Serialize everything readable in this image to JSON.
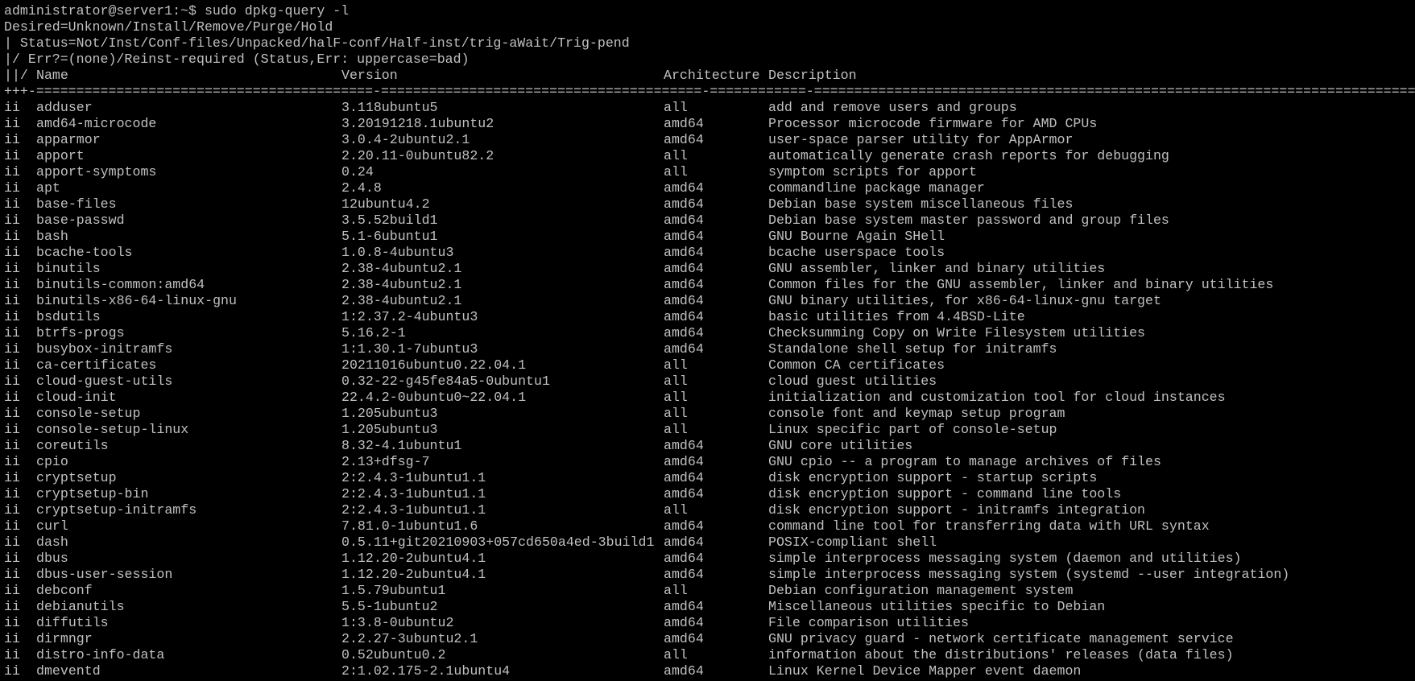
{
  "terminal": {
    "prompt": "administrator@server1:~$ sudo dpkg-query -l",
    "header_lines": [
      "Desired=Unknown/Install/Remove/Purge/Hold",
      "| Status=Not/Inst/Conf-files/Unpacked/halF-conf/Half-inst/trig-aWait/Trig-pend",
      "|/ Err?=(none)/Reinst-required (Status,Err: uppercase=bad)"
    ],
    "columns": {
      "status": "||/",
      "name": "Name",
      "version": "Version",
      "arch": "Architecture",
      "desc": "Description"
    },
    "separator": "+++-==========================================-========================================-============-===============================================================================",
    "packages": [
      {
        "status": "ii",
        "name": "adduser",
        "version": "3.118ubuntu5",
        "arch": "all",
        "desc": "add and remove users and groups"
      },
      {
        "status": "ii",
        "name": "amd64-microcode",
        "version": "3.20191218.1ubuntu2",
        "arch": "amd64",
        "desc": "Processor microcode firmware for AMD CPUs"
      },
      {
        "status": "ii",
        "name": "apparmor",
        "version": "3.0.4-2ubuntu2.1",
        "arch": "amd64",
        "desc": "user-space parser utility for AppArmor"
      },
      {
        "status": "ii",
        "name": "apport",
        "version": "2.20.11-0ubuntu82.2",
        "arch": "all",
        "desc": "automatically generate crash reports for debugging"
      },
      {
        "status": "ii",
        "name": "apport-symptoms",
        "version": "0.24",
        "arch": "all",
        "desc": "symptom scripts for apport"
      },
      {
        "status": "ii",
        "name": "apt",
        "version": "2.4.8",
        "arch": "amd64",
        "desc": "commandline package manager"
      },
      {
        "status": "ii",
        "name": "base-files",
        "version": "12ubuntu4.2",
        "arch": "amd64",
        "desc": "Debian base system miscellaneous files"
      },
      {
        "status": "ii",
        "name": "base-passwd",
        "version": "3.5.52build1",
        "arch": "amd64",
        "desc": "Debian base system master password and group files"
      },
      {
        "status": "ii",
        "name": "bash",
        "version": "5.1-6ubuntu1",
        "arch": "amd64",
        "desc": "GNU Bourne Again SHell"
      },
      {
        "status": "ii",
        "name": "bcache-tools",
        "version": "1.0.8-4ubuntu3",
        "arch": "amd64",
        "desc": "bcache userspace tools"
      },
      {
        "status": "ii",
        "name": "binutils",
        "version": "2.38-4ubuntu2.1",
        "arch": "amd64",
        "desc": "GNU assembler, linker and binary utilities"
      },
      {
        "status": "ii",
        "name": "binutils-common:amd64",
        "version": "2.38-4ubuntu2.1",
        "arch": "amd64",
        "desc": "Common files for the GNU assembler, linker and binary utilities"
      },
      {
        "status": "ii",
        "name": "binutils-x86-64-linux-gnu",
        "version": "2.38-4ubuntu2.1",
        "arch": "amd64",
        "desc": "GNU binary utilities, for x86-64-linux-gnu target"
      },
      {
        "status": "ii",
        "name": "bsdutils",
        "version": "1:2.37.2-4ubuntu3",
        "arch": "amd64",
        "desc": "basic utilities from 4.4BSD-Lite"
      },
      {
        "status": "ii",
        "name": "btrfs-progs",
        "version": "5.16.2-1",
        "arch": "amd64",
        "desc": "Checksumming Copy on Write Filesystem utilities"
      },
      {
        "status": "ii",
        "name": "busybox-initramfs",
        "version": "1:1.30.1-7ubuntu3",
        "arch": "amd64",
        "desc": "Standalone shell setup for initramfs"
      },
      {
        "status": "ii",
        "name": "ca-certificates",
        "version": "20211016ubuntu0.22.04.1",
        "arch": "all",
        "desc": "Common CA certificates"
      },
      {
        "status": "ii",
        "name": "cloud-guest-utils",
        "version": "0.32-22-g45fe84a5-0ubuntu1",
        "arch": "all",
        "desc": "cloud guest utilities"
      },
      {
        "status": "ii",
        "name": "cloud-init",
        "version": "22.4.2-0ubuntu0~22.04.1",
        "arch": "all",
        "desc": "initialization and customization tool for cloud instances"
      },
      {
        "status": "ii",
        "name": "console-setup",
        "version": "1.205ubuntu3",
        "arch": "all",
        "desc": "console font and keymap setup program"
      },
      {
        "status": "ii",
        "name": "console-setup-linux",
        "version": "1.205ubuntu3",
        "arch": "all",
        "desc": "Linux specific part of console-setup"
      },
      {
        "status": "ii",
        "name": "coreutils",
        "version": "8.32-4.1ubuntu1",
        "arch": "amd64",
        "desc": "GNU core utilities"
      },
      {
        "status": "ii",
        "name": "cpio",
        "version": "2.13+dfsg-7",
        "arch": "amd64",
        "desc": "GNU cpio -- a program to manage archives of files"
      },
      {
        "status": "ii",
        "name": "cryptsetup",
        "version": "2:2.4.3-1ubuntu1.1",
        "arch": "amd64",
        "desc": "disk encryption support - startup scripts"
      },
      {
        "status": "ii",
        "name": "cryptsetup-bin",
        "version": "2:2.4.3-1ubuntu1.1",
        "arch": "amd64",
        "desc": "disk encryption support - command line tools"
      },
      {
        "status": "ii",
        "name": "cryptsetup-initramfs",
        "version": "2:2.4.3-1ubuntu1.1",
        "arch": "all",
        "desc": "disk encryption support - initramfs integration"
      },
      {
        "status": "ii",
        "name": "curl",
        "version": "7.81.0-1ubuntu1.6",
        "arch": "amd64",
        "desc": "command line tool for transferring data with URL syntax"
      },
      {
        "status": "ii",
        "name": "dash",
        "version": "0.5.11+git20210903+057cd650a4ed-3build1",
        "arch": "amd64",
        "desc": "POSIX-compliant shell"
      },
      {
        "status": "ii",
        "name": "dbus",
        "version": "1.12.20-2ubuntu4.1",
        "arch": "amd64",
        "desc": "simple interprocess messaging system (daemon and utilities)"
      },
      {
        "status": "ii",
        "name": "dbus-user-session",
        "version": "1.12.20-2ubuntu4.1",
        "arch": "amd64",
        "desc": "simple interprocess messaging system (systemd --user integration)"
      },
      {
        "status": "ii",
        "name": "debconf",
        "version": "1.5.79ubuntu1",
        "arch": "all",
        "desc": "Debian configuration management system"
      },
      {
        "status": "ii",
        "name": "debianutils",
        "version": "5.5-1ubuntu2",
        "arch": "amd64",
        "desc": "Miscellaneous utilities specific to Debian"
      },
      {
        "status": "ii",
        "name": "diffutils",
        "version": "1:3.8-0ubuntu2",
        "arch": "amd64",
        "desc": "File comparison utilities"
      },
      {
        "status": "ii",
        "name": "dirmngr",
        "version": "2.2.27-3ubuntu2.1",
        "arch": "amd64",
        "desc": "GNU privacy guard - network certificate management service"
      },
      {
        "status": "ii",
        "name": "distro-info-data",
        "version": "0.52ubuntu0.2",
        "arch": "all",
        "desc": "information about the distributions' releases (data files)"
      },
      {
        "status": "ii",
        "name": "dmeventd",
        "version": "2:1.02.175-2.1ubuntu4",
        "arch": "amd64",
        "desc": "Linux Kernel Device Mapper event daemon"
      }
    ]
  },
  "colors": {
    "background": "#000000",
    "foreground": "#c0c0c0"
  }
}
